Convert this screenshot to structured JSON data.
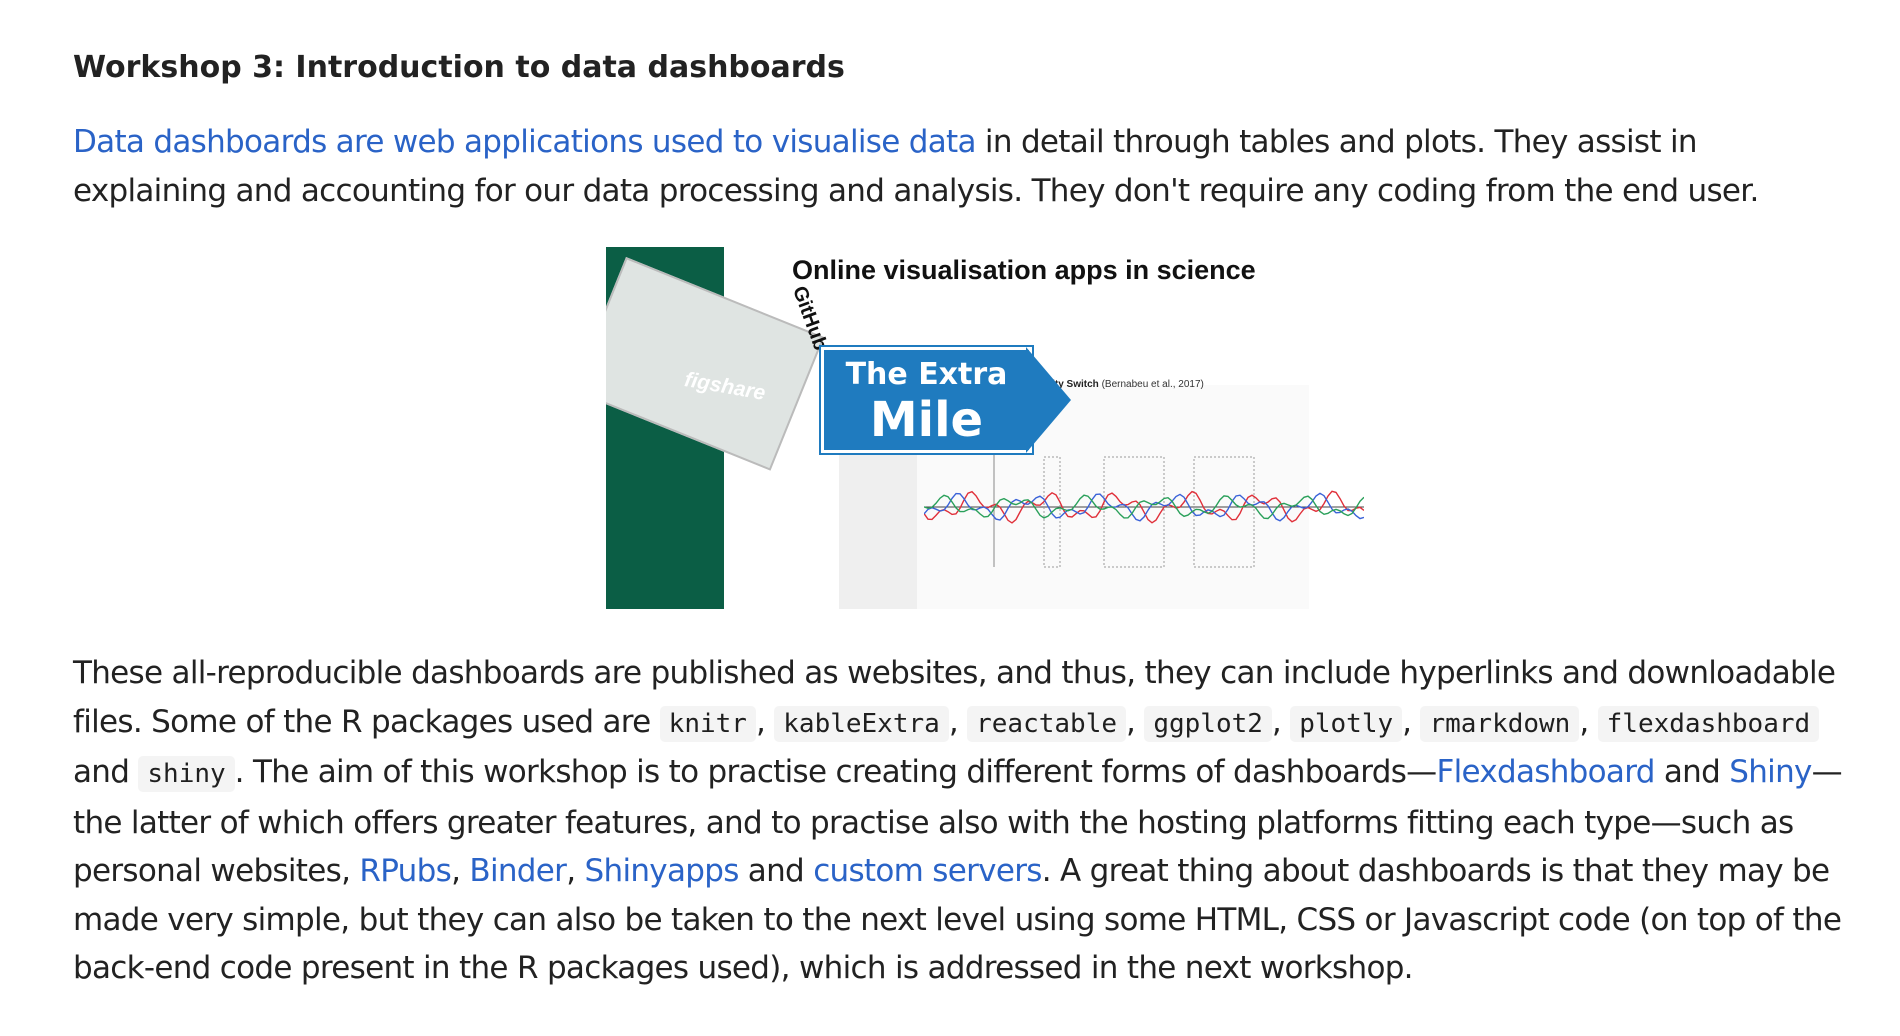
{
  "heading": "Workshop 3: Introduction to data dashboards",
  "intro": {
    "link_text": "Data dashboards are web applications used to visualise data",
    "rest": " in detail through tables and plots. They assist in explaining and accounting for our data processing and analysis. They don't require any coding from the end user."
  },
  "figure": {
    "title": "Online visualisation apps in science",
    "sign_line1": "The Extra",
    "sign_line2": "Mile",
    "figshare": "figshare",
    "github": "GitHub",
    "chart_caption_bold": "Conceptual Modality Switch",
    "chart_caption": " (Bernabeu et al., 2017)",
    "colors": {
      "green_panel": "#0b5e45",
      "sign_blue": "#1f7bbf",
      "series_red": "#e0303a",
      "series_blue": "#3a62d8",
      "series_green": "#2aa05a"
    }
  },
  "body": {
    "t1": "These all-reproducible dashboards are published as websites, and thus, they can include hyperlinks and downloadable files. Some of the R packages used are ",
    "pkg1": "knitr",
    "sep1": ", ",
    "pkg2": "kableExtra",
    "sep2": ", ",
    "pkg3": "reactable",
    "sep3": ", ",
    "pkg4": "ggplot2",
    "sep4": ", ",
    "pkg5": "plotly",
    "sep5": ", ",
    "pkg6": "rmarkdown",
    "sep6": ", ",
    "pkg7": "flexdashboard",
    "and1": " and ",
    "pkg8": "shiny",
    "t2": ". The aim of this workshop is to practise creating different forms of dashboards—",
    "link_flex": "Flexdashboard",
    "and2": " and ",
    "link_shiny": "Shiny",
    "t3": "—the latter of which offers greater features, and to practise also with the hosting platforms fitting each type—such as personal websites, ",
    "link_rpubs": "RPubs",
    "c1": ", ",
    "link_binder": "Binder",
    "c2": ", ",
    "link_shinyapps": "Shinyapps",
    "and3": " and ",
    "link_custom": "custom servers",
    "t4": ". A great thing about dashboards is that they may be made very simple, but they can also be taken to the next level using some HTML, CSS or Javascript code (on top of the back-end code present in the R packages used), which is addressed in the next workshop."
  }
}
